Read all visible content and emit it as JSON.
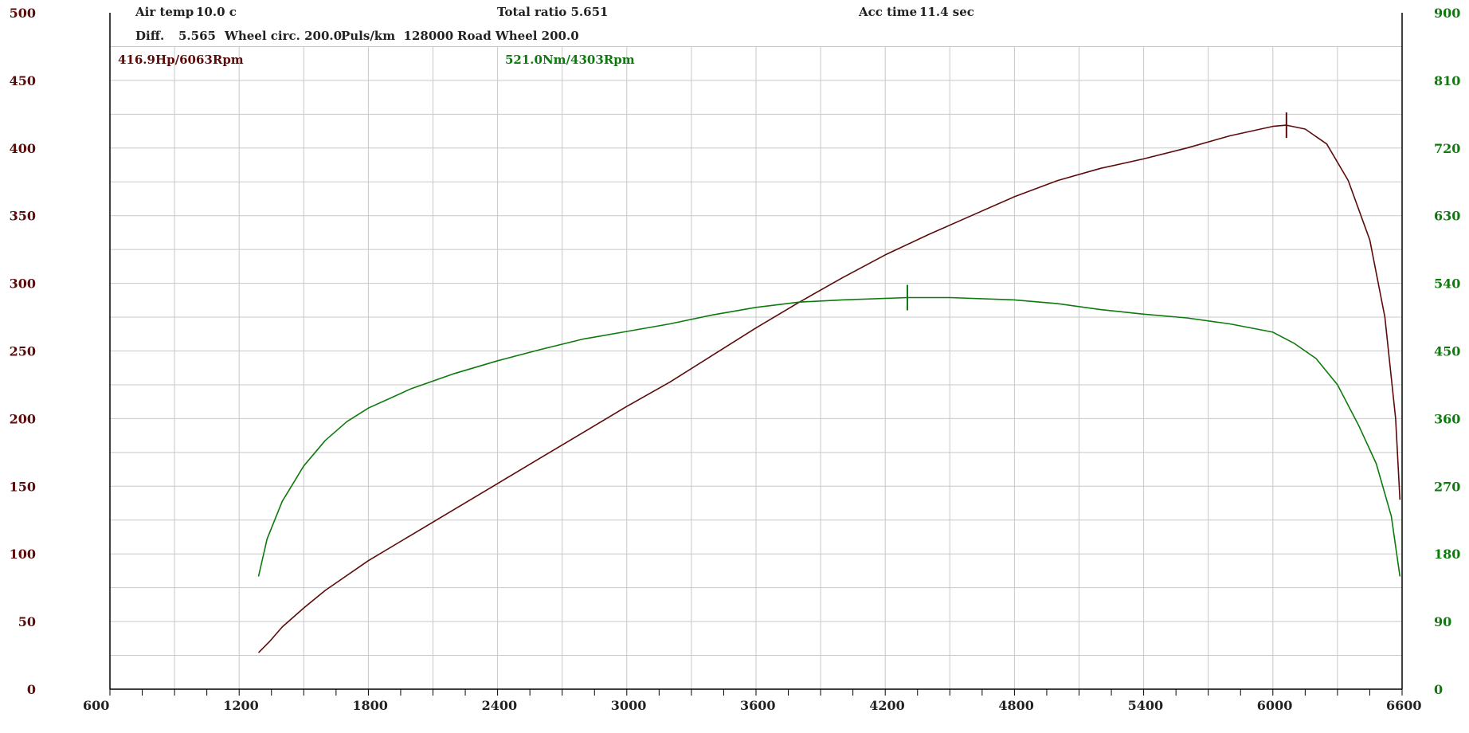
{
  "header": {
    "air_temp_label": "Air temp",
    "air_temp_value": "10.0 c",
    "total_ratio": "Total ratio 5.651",
    "acc_time_label": "Acc time",
    "acc_time_value": "11.4 sec",
    "diff_label": "Diff.",
    "diff_value": "5.565",
    "wheel_circ": "Wheel circ. 200.0",
    "puls_km": "Puls/km  128000",
    "road_wheel": "Road Wheel 200.0"
  },
  "peaks": {
    "power": "416.9Hp/6063Rpm",
    "torque": "521.0Nm/4303Rpm"
  },
  "colors": {
    "power": "#5c0a0a",
    "torque": "#0d7a0d",
    "grid": "#c8c8c8",
    "axis": "#000000"
  },
  "chart_data": {
    "type": "line",
    "title": "",
    "xlabel": "",
    "ylabel": "",
    "xlim": [
      600,
      6600
    ],
    "ylim": [
      0,
      500
    ],
    "y2lim": [
      0,
      900
    ],
    "grid": true,
    "x_ticks": [
      600,
      1200,
      1800,
      2400,
      3000,
      3600,
      4200,
      4800,
      5400,
      6000,
      6600
    ],
    "y_ticks": [
      0,
      50,
      100,
      150,
      200,
      250,
      300,
      350,
      400,
      450,
      500
    ],
    "y2_ticks": [
      0,
      90,
      180,
      270,
      360,
      450,
      540,
      630,
      720,
      810,
      900
    ],
    "series": [
      {
        "axis": "left",
        "color": "#5c0a0a",
        "peak_marker": [
          6063,
          416.9
        ],
        "x": [
          1290,
          1340,
          1400,
          1500,
          1600,
          1800,
          2000,
          2200,
          2400,
          2600,
          2800,
          3000,
          3200,
          3400,
          3600,
          3800,
          4000,
          4200,
          4400,
          4600,
          4800,
          5000,
          5200,
          5400,
          5600,
          5800,
          6000,
          6063,
          6150,
          6250,
          6350,
          6450,
          6520,
          6570,
          6590
        ],
        "y": [
          27,
          35,
          46,
          60,
          73,
          95,
          114,
          133,
          152,
          171,
          190,
          209,
          227,
          247,
          267,
          286,
          304,
          321,
          336,
          350,
          364,
          376,
          385,
          392,
          400,
          409,
          416,
          416.9,
          414,
          403,
          376,
          332,
          275,
          200,
          140
        ]
      },
      {
        "axis": "right",
        "color": "#0d7a0d",
        "peak_marker": [
          4303,
          521.0
        ],
        "x": [
          1290,
          1330,
          1400,
          1500,
          1600,
          1700,
          1800,
          2000,
          2200,
          2400,
          2600,
          2800,
          3000,
          3200,
          3400,
          3600,
          3800,
          4000,
          4303,
          4500,
          4800,
          5000,
          5200,
          5400,
          5600,
          5800,
          6000,
          6100,
          6200,
          6300,
          6400,
          6480,
          6550,
          6590
        ],
        "y": [
          150,
          200,
          250,
          297,
          331,
          356,
          374,
          400,
          420,
          437,
          452,
          466,
          476,
          486,
          498,
          508,
          515,
          518,
          521,
          521,
          518,
          513,
          505,
          499,
          494,
          486,
          475,
          460,
          440,
          405,
          350,
          300,
          230,
          150
        ]
      }
    ]
  }
}
